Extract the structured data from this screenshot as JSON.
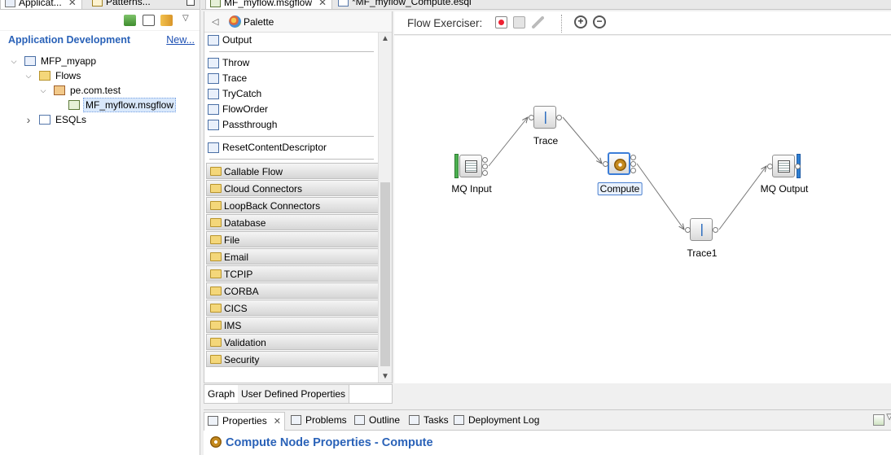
{
  "explorer": {
    "tabs": [
      {
        "label": "Applicat..."
      },
      {
        "label": "Patterns..."
      }
    ],
    "title": "Application Development",
    "new_link": "New...",
    "tree": [
      {
        "label": "MFP_myapp",
        "icon": "application-icon",
        "level": 0,
        "twisty": "expanded"
      },
      {
        "label": "Flows",
        "icon": "flows-folder-icon",
        "level": 1,
        "twisty": "expanded"
      },
      {
        "label": "pe.com.test",
        "icon": "package-icon",
        "level": 2,
        "twisty": "expanded"
      },
      {
        "label": "MF_myflow.msgflow",
        "icon": "msgflow-file-icon",
        "level": 3,
        "twisty": "none",
        "selected": true
      },
      {
        "label": "ESQLs",
        "icon": "esql-folder-icon",
        "level": 1,
        "twisty": "collapsed"
      }
    ]
  },
  "editor": {
    "tabs": [
      {
        "label": "MF_myflow.msgflow",
        "active": true
      },
      {
        "label": "*MF_myflow_Compute.esql",
        "active": false
      }
    ]
  },
  "palette": {
    "title": "Palette",
    "items": [
      {
        "label": "Output"
      },
      {
        "label": "Throw"
      },
      {
        "label": "Trace"
      },
      {
        "label": "TryCatch"
      },
      {
        "label": "FlowOrder"
      },
      {
        "label": "Passthrough"
      },
      {
        "label": "ResetContentDescriptor"
      }
    ],
    "drawers": [
      {
        "label": "Callable Flow"
      },
      {
        "label": "Cloud Connectors"
      },
      {
        "label": "LoopBack Connectors"
      },
      {
        "label": "Database"
      },
      {
        "label": "File"
      },
      {
        "label": "Email"
      },
      {
        "label": "TCPIP"
      },
      {
        "label": "CORBA"
      },
      {
        "label": "CICS"
      },
      {
        "label": "IMS"
      },
      {
        "label": "Validation"
      },
      {
        "label": "Security"
      }
    ]
  },
  "graph_tabs": [
    {
      "label": "Graph",
      "active": true
    },
    {
      "label": "User Defined Properties",
      "active": false
    }
  ],
  "flow_exerciser": {
    "label": "Flow Exerciser:"
  },
  "flow": {
    "nodes": [
      {
        "name": "MQ Input",
        "type": "mq-input"
      },
      {
        "name": "Trace",
        "type": "trace"
      },
      {
        "name": "Compute",
        "type": "compute",
        "selected": true
      },
      {
        "name": "Trace1",
        "type": "trace"
      },
      {
        "name": "MQ Output",
        "type": "mq-output"
      }
    ],
    "connections": [
      [
        "MQ Input",
        "Trace"
      ],
      [
        "Trace",
        "Compute"
      ],
      [
        "Compute",
        "Trace1"
      ],
      [
        "Trace1",
        "MQ Output"
      ]
    ]
  },
  "bottom_tabs": [
    {
      "label": "Properties",
      "active": true
    },
    {
      "label": "Problems"
    },
    {
      "label": "Outline"
    },
    {
      "label": "Tasks"
    },
    {
      "label": "Deployment Log"
    }
  ],
  "properties": {
    "title": "Compute Node Properties - Compute"
  },
  "colors": {
    "accent_blue": "#2a62b8",
    "selection": "#d9e8fb",
    "mq_green": "#4caf50",
    "mq_blue": "#2f7fd1"
  }
}
